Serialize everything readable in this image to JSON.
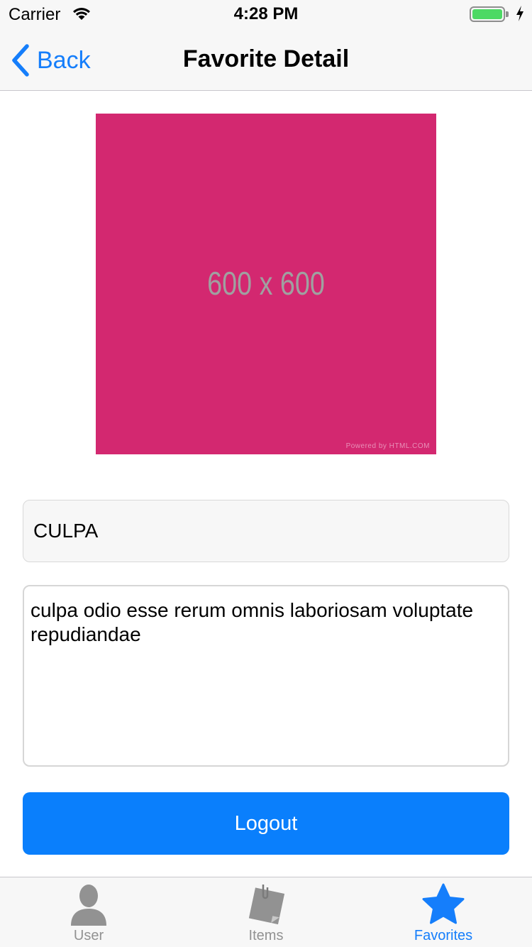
{
  "status_bar": {
    "carrier": "Carrier",
    "time": "4:28 PM",
    "battery_level": 1.0,
    "battery_color": "#4cd964",
    "wifi_icon": "wifi-icon",
    "charging_icon": "bolt-icon"
  },
  "nav": {
    "back_label": "Back",
    "title": "Favorite Detail",
    "accent": "#157efb"
  },
  "image": {
    "label": "600 x 600",
    "credit": "Powered by HTML.COM",
    "color": "#d32870"
  },
  "form": {
    "title_value": "CULPA",
    "description_value": "culpa odio esse rerum omnis laboriosam voluptate repudiandae"
  },
  "logout_button": {
    "label": "Logout",
    "color": "#0a7ffc"
  },
  "tab_bar": {
    "tabs": [
      {
        "label": "User",
        "icon": "user-icon",
        "active": false
      },
      {
        "label": "Items",
        "icon": "notes-icon",
        "active": false
      },
      {
        "label": "Favorites",
        "icon": "star-icon",
        "active": true
      }
    ]
  }
}
